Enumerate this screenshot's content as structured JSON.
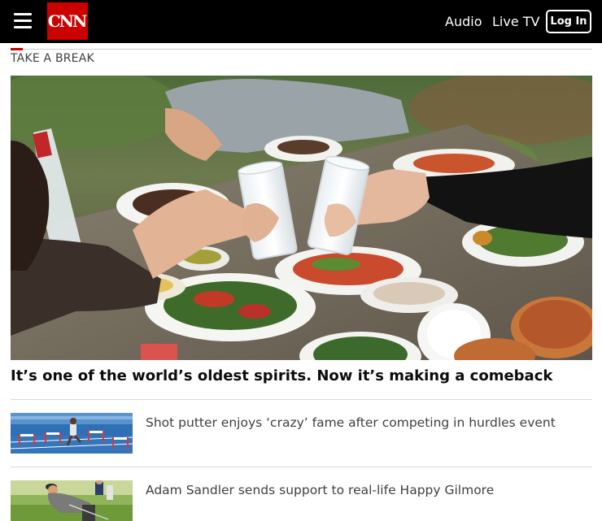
{
  "header": {
    "logo_text": "CNN",
    "nav": {
      "audio": "Audio",
      "live_tv": "Live TV"
    },
    "login_label": "Log In"
  },
  "section": {
    "title": "TAKE A BREAK"
  },
  "featured": {
    "headline": "It’s one of the world’s oldest spirits. Now it’s making a comeback"
  },
  "stories": [
    {
      "title": "Shot putter enjoys ‘crazy’ fame after competing in hurdles event"
    },
    {
      "title": "Adam Sandler sends support to real-life Happy Gilmore"
    }
  ],
  "colors": {
    "brand_red": "#cc0000",
    "header_bg": "#000000"
  },
  "icons": {
    "menu": "hamburger-menu-icon"
  }
}
